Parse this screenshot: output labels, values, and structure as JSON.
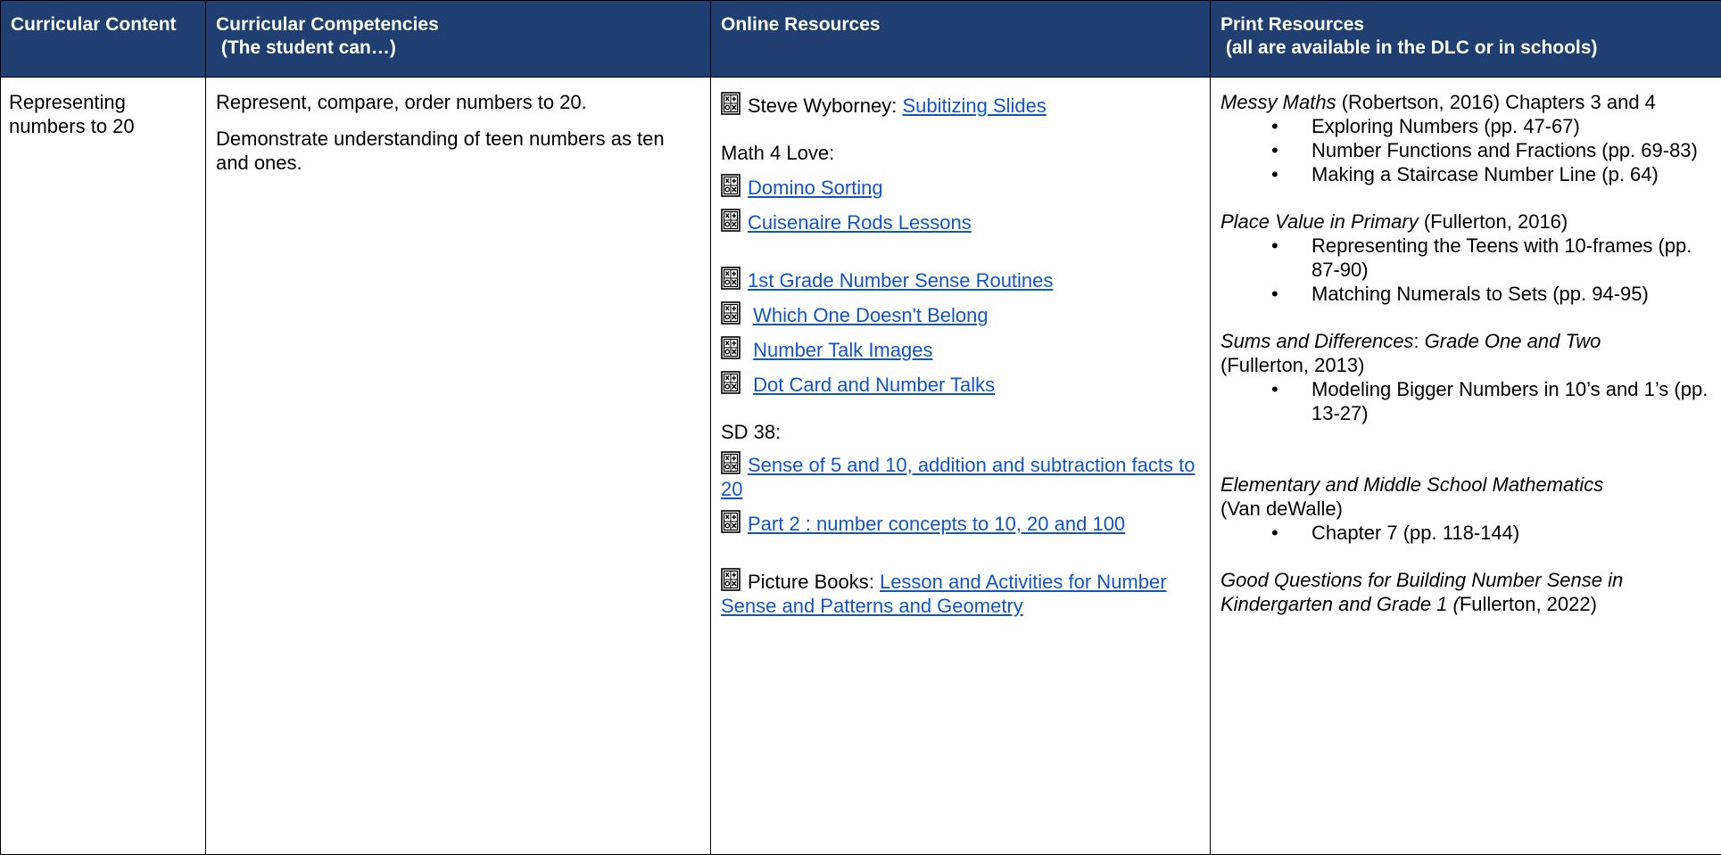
{
  "headers": {
    "curricular_content": "Curricular Content",
    "competencies_line1": "Curricular Competencies",
    "competencies_line2": " (The student can…)",
    "online": "Online Resources",
    "print_line1": "Print Resources",
    "print_line2": " (all are available in the DLC or in schools)"
  },
  "content": {
    "topic": "Representing numbers to 20"
  },
  "competencies": [
    "Represent, compare, order numbers to 20.",
    "Demonstrate understanding of teen numbers as ten and ones."
  ],
  "online": {
    "wyborney_prefix": "Steve Wyborney: ",
    "wyborney_link": "Subitizing Slides",
    "math4love_heading": "Math 4 Love:",
    "domino": "Domino Sorting",
    "cuisenaire": "Cuisenaire Rods Lessons",
    "first_grade": "1st Grade Number Sense Routines",
    "which_one": "Which One Doesn't Belong",
    "number_talk": "Number Talk Images",
    "dot_card": "Dot Card and Number Talks",
    "sd38_heading": "SD 38:",
    "sense_of_5": "Sense of 5 and 10, addition and subtraction facts to 20",
    "part2": "Part 2 : number concepts to 10, 20 and 100",
    "picture_books_prefix": "Picture Books: ",
    "picture_books_link": "Lesson and Activities for Number Sense and Patterns and Geometry"
  },
  "print": {
    "messy_title": "Messy Maths",
    "messy_rest": " (Robertson, 2016) Chapters 3 and 4",
    "messy_items": [
      "Exploring Numbers (pp. 47-67)",
      "Number Functions and Fractions (pp. 69-83)",
      "Making a Staircase Number Line (p. 64)"
    ],
    "place_title": "Place Value in Primary",
    "place_rest": " (Fullerton, 2016)",
    "place_items": [
      "Representing the Teens with 10-frames (pp. 87-90)",
      "Matching Numerals to Sets (pp. 94-95)"
    ],
    "sums_title": "Sums and Differences",
    "sums_colon": ": ",
    "sums_sub": "Grade One and Two",
    "sums_rest": "(Fullerton, 2013)",
    "sums_items": [
      "Modeling Bigger Numbers in 10’s and 1’s (pp. 13-27)"
    ],
    "elem_title": "Elementary and Middle School Mathematics",
    "elem_rest": "(Van deWalle)",
    "elem_items": [
      "Chapter 7 (pp. 118-144)"
    ],
    "good_title": "Good Questions for Building Number Sense in Kindergarten and Grade 1 (",
    "good_rest": "Fullerton, 2022)"
  },
  "colors": {
    "header_bg": "#1f3f72",
    "header_text": "#ffffff",
    "link": "#1155cc"
  },
  "icons": {
    "resource_icon": "calculator-icon"
  }
}
